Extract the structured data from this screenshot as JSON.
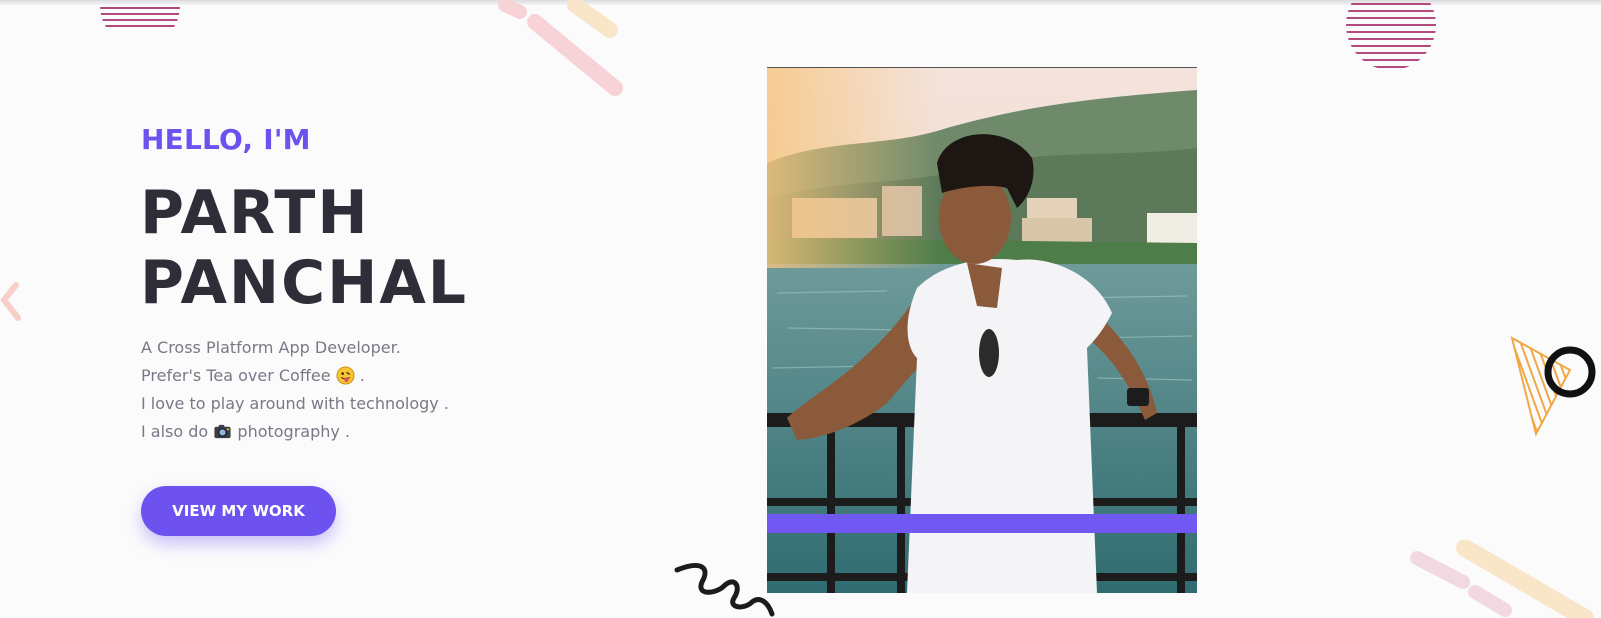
{
  "hero": {
    "greeting": "HELLO, I'M",
    "name_line1": "PARTH",
    "name_line2": "PANCHAL",
    "bio": {
      "line1": "A Cross Platform App Developer.",
      "line2_before": "Prefer's Tea over Coffee",
      "line2_after": ".",
      "line3": "I love to play around with technology .",
      "line4_before": "I also do",
      "line4_after": "photography ."
    },
    "cta_label": "VIEW MY WORK"
  },
  "icons": {
    "emoji_tongue": "tongue-out-emoji-icon",
    "emoji_camera": "camera-emoji-icon"
  },
  "colors": {
    "accent": "#6e52f0",
    "heading": "#2e2d38",
    "body_text": "#7a7886",
    "background": "#fbfbfc"
  }
}
